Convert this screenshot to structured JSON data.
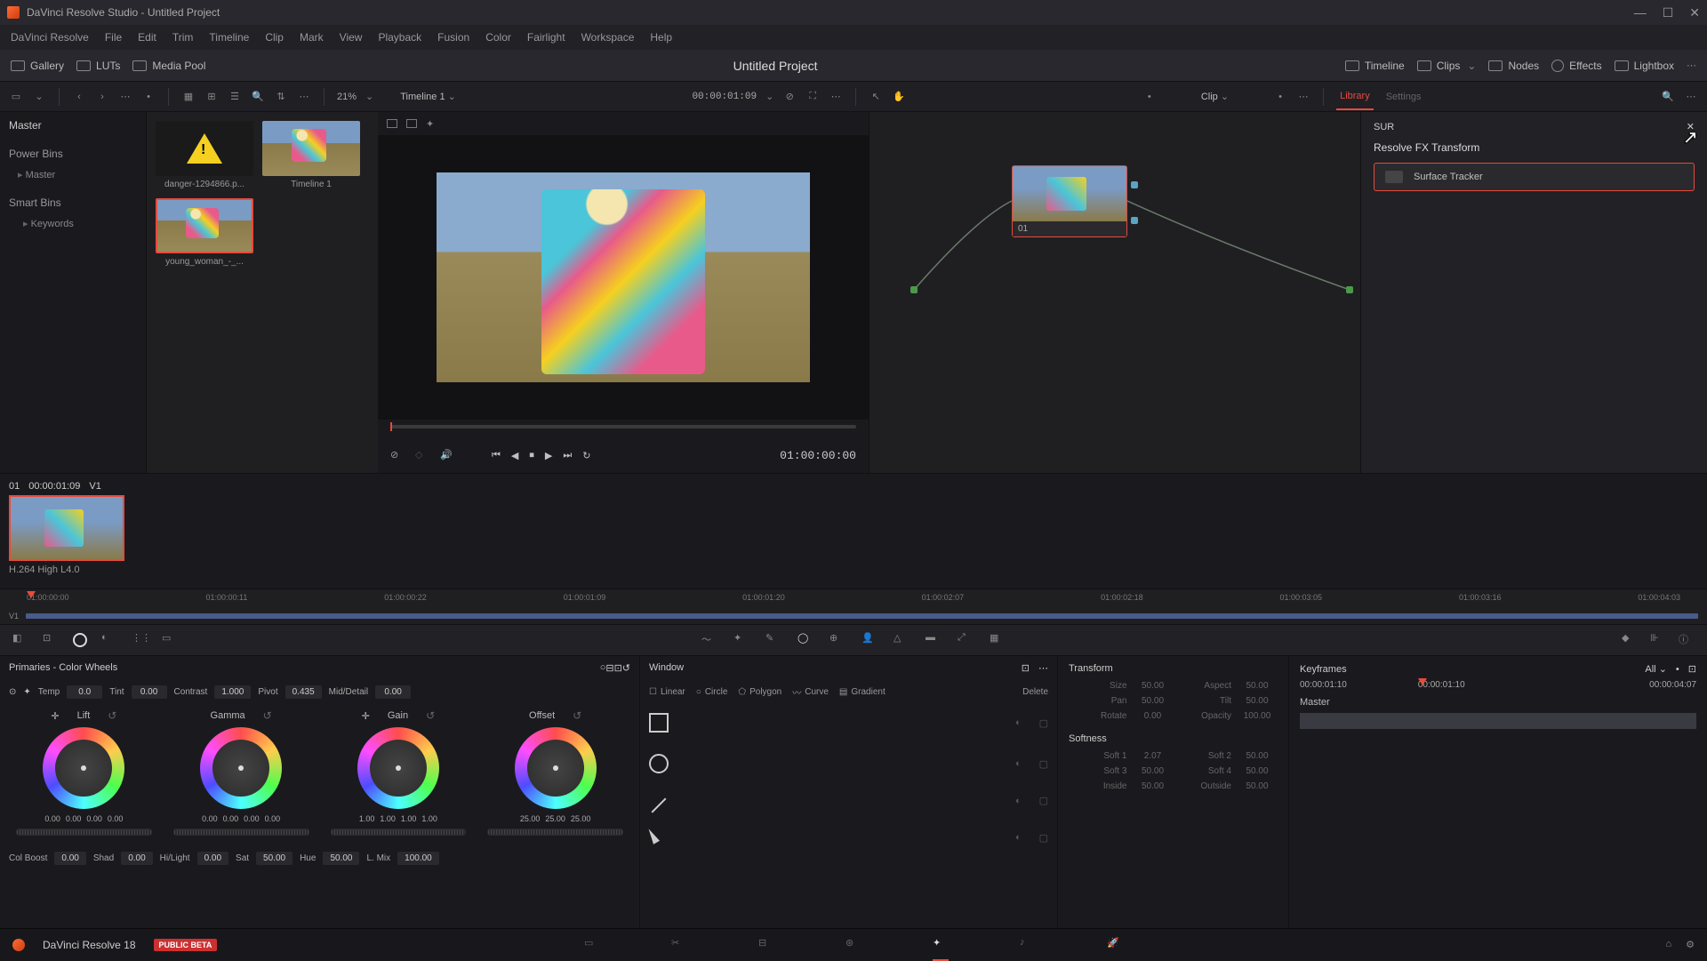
{
  "titlebar": {
    "title": "DaVinci Resolve Studio - Untitled Project"
  },
  "menubar": [
    "DaVinci Resolve",
    "File",
    "Edit",
    "Trim",
    "Timeline",
    "Clip",
    "Mark",
    "View",
    "Playback",
    "Fusion",
    "Color",
    "Fairlight",
    "Workspace",
    "Help"
  ],
  "toptool": {
    "project_title": "Untitled Project",
    "left": {
      "gallery": "Gallery",
      "luts": "LUTs",
      "mediapool": "Media Pool"
    },
    "right": {
      "timeline": "Timeline",
      "clips": "Clips",
      "nodes": "Nodes",
      "effects": "Effects",
      "lightbox": "Lightbox"
    }
  },
  "subtool": {
    "zoom": "21%",
    "timeline_label": "Timeline 1",
    "timecode": "00:00:01:09",
    "clip_label": "Clip",
    "library_tab": "Library",
    "settings_tab": "Settings"
  },
  "pool": {
    "master": "Master",
    "powerbins": "Power Bins",
    "master_item": "Master",
    "smartbins": "Smart Bins",
    "keywords": "Keywords"
  },
  "thumbs": [
    {
      "label": "danger-1294866.p..."
    },
    {
      "label": "Timeline 1"
    },
    {
      "label": "young_woman_-_..."
    }
  ],
  "viewer": {
    "tc": "01:00:00:00"
  },
  "node": {
    "label": "01"
  },
  "library": {
    "search": "SUR",
    "group": "Resolve FX Transform",
    "item": "Surface Tracker"
  },
  "clipstrip": {
    "num": "01",
    "tc": "00:00:01:09",
    "track": "V1",
    "codec": "H.264 High L4.0"
  },
  "ruler_marks": [
    "01:00:00:00",
    "01:00:00:11",
    "01:00:00:22",
    "01:00:01:09",
    "01:00:01:20",
    "01:00:02:07",
    "01:00:02:18",
    "01:00:03:05",
    "01:00:03:16",
    "01:00:04:03"
  ],
  "ruler_track": "V1",
  "primaries": {
    "header": "Primaries - Color Wheels",
    "adjust": {
      "temp_l": "Temp",
      "temp_v": "0.0",
      "tint_l": "Tint",
      "tint_v": "0.00",
      "contrast_l": "Contrast",
      "contrast_v": "1.000",
      "pivot_l": "Pivot",
      "pivot_v": "0.435",
      "mid_l": "Mid/Detail",
      "mid_v": "0.00"
    },
    "wheels": {
      "lift": {
        "label": "Lift",
        "nums": [
          "0.00",
          "0.00",
          "0.00",
          "0.00"
        ]
      },
      "gamma": {
        "label": "Gamma",
        "nums": [
          "0.00",
          "0.00",
          "0.00",
          "0.00"
        ]
      },
      "gain": {
        "label": "Gain",
        "nums": [
          "1.00",
          "1.00",
          "1.00",
          "1.00"
        ]
      },
      "offset": {
        "label": "Offset",
        "nums": [
          "25.00",
          "25.00",
          "25.00"
        ]
      }
    },
    "bottom": {
      "colboost_l": "Col Boost",
      "colboost_v": "0.00",
      "shad_l": "Shad",
      "shad_v": "0.00",
      "hilight_l": "Hi/Light",
      "hilight_v": "0.00",
      "sat_l": "Sat",
      "sat_v": "50.00",
      "hue_l": "Hue",
      "hue_v": "50.00",
      "lmix_l": "L. Mix",
      "lmix_v": "100.00"
    }
  },
  "window": {
    "header": "Window",
    "tools": {
      "linear": "Linear",
      "circle": "Circle",
      "polygon": "Polygon",
      "curve": "Curve",
      "gradient": "Gradient",
      "delete": "Delete"
    }
  },
  "transform": {
    "header": "Transform",
    "rows": [
      {
        "l1": "Size",
        "v1": "50.00",
        "l2": "Aspect",
        "v2": "50.00"
      },
      {
        "l1": "Pan",
        "v1": "50.00",
        "l2": "Tilt",
        "v2": "50.00"
      },
      {
        "l1": "Rotate",
        "v1": "0.00",
        "l2": "Opacity",
        "v2": "100.00"
      }
    ],
    "softness": "Softness",
    "soft_rows": [
      {
        "l1": "Soft 1",
        "v1": "2.07",
        "l2": "Soft 2",
        "v2": "50.00"
      },
      {
        "l1": "Soft 3",
        "v1": "50.00",
        "l2": "Soft 4",
        "v2": "50.00"
      },
      {
        "l1": "Inside",
        "v1": "50.00",
        "l2": "Outside",
        "v2": "50.00"
      }
    ]
  },
  "keyframes": {
    "header": "Keyframes",
    "all": "All",
    "tc1": "00:00:01:10",
    "tc2": "00:00:01:10",
    "tc3": "00:00:04:07",
    "master": "Master"
  },
  "pagebar": {
    "appname": "DaVinci Resolve 18",
    "beta": "PUBLIC BETA"
  }
}
